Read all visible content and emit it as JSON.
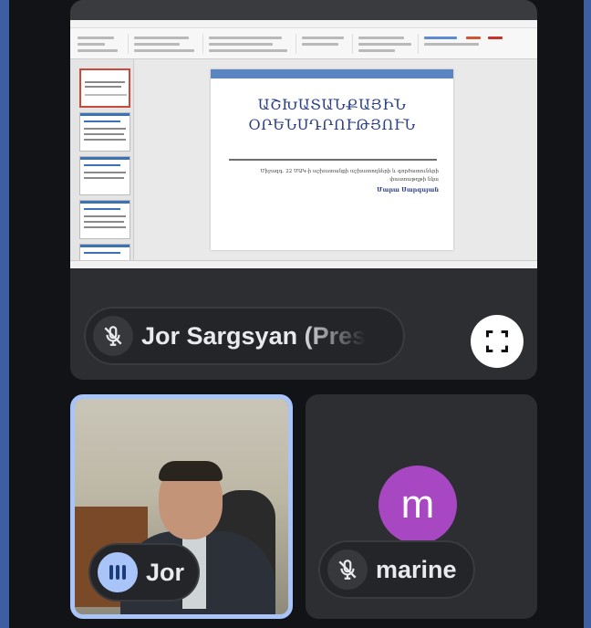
{
  "slide": {
    "title_line1": "ԱՇԽԱՏԱՆՔԱՅԻՆ",
    "title_line2": "ՕՐԵՆՍԴՐՈՒԹՅՈՒՆ",
    "subtitle_line1": "Միջազգ. 22 ՄԱԿ-ի աշխատանքի աշխատողների և գործատուների",
    "subtitle_line2": "փաստաթղթի նկա",
    "author": "Մարա Սարգսյան"
  },
  "presenter": {
    "name": "Jor Sargsyan (Pres"
  },
  "participants": [
    {
      "name": "Jor",
      "speaking": true
    },
    {
      "name": "marine",
      "avatar_letter": "m",
      "muted": true,
      "avatar_color": "#a747c2"
    }
  ],
  "colors": {
    "background": "#3b5fa0",
    "active_speaker": "#a8c4f8"
  }
}
